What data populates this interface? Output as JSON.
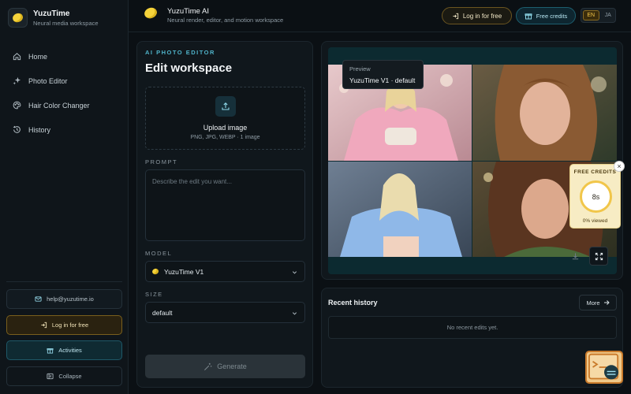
{
  "app": {
    "name": "YuzuTime",
    "tagline": "Neural media workspace"
  },
  "sidebar": {
    "items": [
      {
        "label": "Home",
        "icon": "home-icon"
      },
      {
        "label": "Photo Editor",
        "icon": "sparkles-icon"
      },
      {
        "label": "Hair Color Changer",
        "icon": "palette-icon"
      },
      {
        "label": "History",
        "icon": "history-icon"
      }
    ],
    "email": "help@yuzutime.io",
    "login": "Log in for free",
    "activities": "Activities",
    "collapse": "Collapse"
  },
  "header": {
    "title": "YuzuTime AI",
    "subtitle": "Neural render, editor, and motion workspace",
    "login": "Log in for free",
    "credits": "Free credits",
    "lang_active": "EN",
    "lang_other": "JA"
  },
  "editor": {
    "kicker": "AI PHOTO EDITOR",
    "title": "Edit workspace",
    "upload_title": "Upload image",
    "upload_sub": "PNG, JPG, WEBP · 1 image",
    "prompt_label": "PROMPT",
    "prompt_placeholder": "Describe the edit you want...",
    "model_label": "MODEL",
    "model_value": "YuzuTime V1",
    "size_label": "SIZE",
    "size_value": "default",
    "generate": "Generate"
  },
  "preview": {
    "tooltip_title": "Preview",
    "tooltip_value": "YuzuTime V1 · default"
  },
  "free_credits_widget": {
    "title": "FREE CREDITS",
    "countdown": "8s",
    "viewed": "0% viewed",
    "progress": 0
  },
  "history": {
    "title": "Recent history",
    "more": "More",
    "empty": "No recent edits yet."
  },
  "colors": {
    "accent_gold": "#f5c84a",
    "accent_teal": "#4fb3c9",
    "background": "#0b1014"
  }
}
